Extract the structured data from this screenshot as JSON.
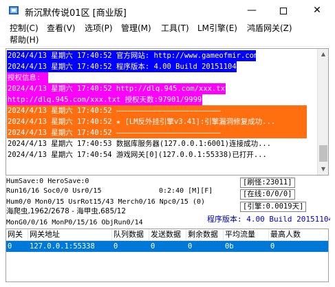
{
  "window": {
    "title": "新沉默传说01区 [商业版]",
    "minimize_glyph": "—",
    "close_glyph": "✕"
  },
  "menu": {
    "items": [
      "控制(C)",
      "查看(V)",
      "选项(P)",
      "管理(M)",
      "工具(T)",
      "LM引擎(E)",
      "鸿盾网关(Z)",
      "帮助(H)"
    ]
  },
  "log": {
    "lines": [
      {
        "text": "2024/4/13 星期六 17:40:52 官方网站: http://www.gameofmir.com",
        "style": "blue"
      },
      {
        "text": "2024/4/13 星期六 17:40:52 程序版本: 4.00 Build 20151104",
        "style": "blue"
      },
      {
        "text": "授权信息:",
        "style": "magenta"
      },
      {
        "text": "2024/4/13 星期六 17:40:52 http://dlq.945.com/xxx.txt",
        "style": "magenta"
      },
      {
        "text": "http://dlq.945.com/xxx.txt 授权天数:97901/99999",
        "style": "magenta"
      },
      {
        "text": "2024/4/13 星期六 17:40:52 ————————————————————————",
        "style": "orange"
      },
      {
        "text": "2024/4/13 星期六 17:40:52 ★ [LM反外挂引擎v3.41]:引擎漏洞修复成功...",
        "style": "orange"
      },
      {
        "text": "2024/4/13 星期六 17:40:52 ————————————————————————",
        "style": "orange"
      },
      {
        "text": "2024/4/13 星期六 17:40:53 数据库服务器(127.0.0.1:6001)连接成功...",
        "style": "plain"
      },
      {
        "text": "2024/4/13 星期六 17:40:54 游戏网关[0](127.0.0.1:55338)已打开...",
        "style": "plain"
      }
    ]
  },
  "status": {
    "line1": "HumSave:0 HeroSave:0",
    "line2": "Run16/16 Soc0/0 Usr0/15",
    "line2_time": "0:2:40 [M][F]",
    "line3": "Hum0/0 Mon0/15 UsrRot15/43 Merch0/16 Npc0/15 (0)",
    "line4": "海爬虫,1962/2678 - 海甲虫,685/12",
    "line5": "MonG0/0/16 MonP0/15/16 ObjRun0/14",
    "refresh": "[刷怪:23011]",
    "online": "[在线:0/0/0]",
    "engine": "[引擎:0.0019天]",
    "version": "程序版本: 4.00 Build 20151104"
  },
  "gateway_table": {
    "headers": [
      "网关",
      "网关地址",
      "队列数据",
      "发送数据",
      "剩余数据",
      "平均流量",
      "最高人数"
    ],
    "rows": [
      [
        "0",
        "127.0.0.1:55338",
        "0",
        "0",
        "0",
        "0b",
        "0"
      ]
    ]
  }
}
